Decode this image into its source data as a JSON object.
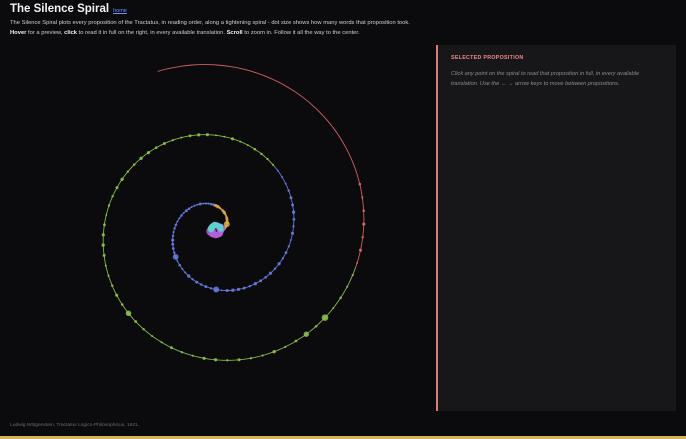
{
  "header": {
    "title": "The Silence Spiral",
    "home_link": "home",
    "intro_line1": "The Silence Spiral plots every proposition of the Tractatus, in reading order, along a tightening spiral - dot size shows how many words that proposition took.",
    "intro_line2": {
      "hover": "Hover",
      "t1": " for a preview, ",
      "click": "click",
      "t2": " to read it in full on the right, in every available translation. ",
      "scroll": "Scroll",
      "t3": " to zoom in. Follow it all the way to the center."
    }
  },
  "panel": {
    "title": "SELECTED PROPOSITION",
    "hint": "Click any point on the spiral to read that proposition in full, in every available translation. Use the ← → arrow keys to move between propositions."
  },
  "footer": {
    "text": "Ludwig Wittgenstein, Tractatus Logico-Philosophicus, 1921."
  },
  "colors": {
    "accent": "#e07a7a",
    "spiral_bands": [
      "#e06a6a",
      "#8fc950",
      "#6b7fe6",
      "#e3aa4a",
      "#b060d8",
      "#5fd0d0"
    ],
    "link": "#6f8fff"
  }
}
